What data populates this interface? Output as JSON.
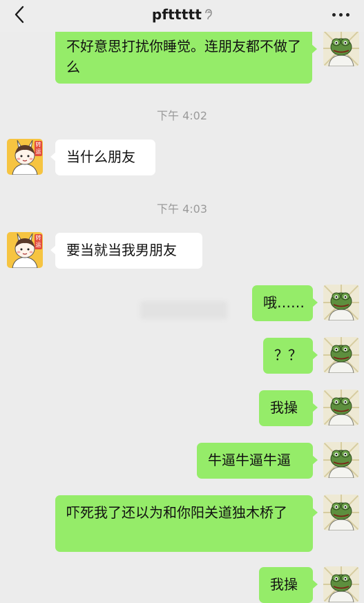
{
  "header": {
    "title": "pfttttt"
  },
  "timestamps": [
    "下午 4:02",
    "下午 4:03"
  ],
  "messages": [
    {
      "from": "me",
      "text": "不好意思打扰你睡觉。连朋友都不做了么"
    },
    {
      "from": "other",
      "text": "当什么朋友"
    },
    {
      "from": "other",
      "text": "要当就当我男朋友"
    },
    {
      "from": "me",
      "text": "哦……"
    },
    {
      "from": "me",
      "text": "？？"
    },
    {
      "from": "me",
      "text": "我操"
    },
    {
      "from": "me",
      "text": "牛逼牛逼牛逼"
    },
    {
      "from": "me",
      "text": "吓死我了还以为和你阳关道独木桥了"
    },
    {
      "from": "me",
      "text": "我操"
    }
  ],
  "avatar_badge_text": "转运",
  "icons": {
    "back": "chevron-left-icon",
    "mute": "ear-icon",
    "more": "more-dots-icon"
  },
  "colors": {
    "my_bubble": "#95ec69",
    "other_bubble": "#ffffff",
    "background": "#ececec"
  }
}
